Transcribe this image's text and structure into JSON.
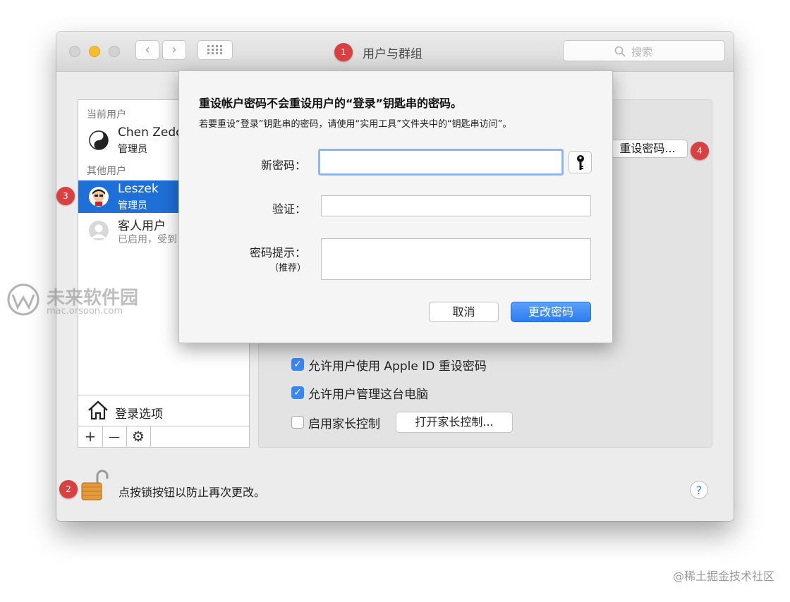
{
  "window": {
    "title": "用户与群组",
    "search_placeholder": "搜索",
    "nav_back": "‹",
    "nav_forward": "›",
    "grid_icon": "grid-icon"
  },
  "badges": [
    "1",
    "2",
    "3",
    "4"
  ],
  "sidebar": {
    "current_section": "当前用户",
    "current_user": {
      "name": "Chen Zedo",
      "role": "管理员",
      "icon": "yin-yang-icon"
    },
    "other_section": "其他用户",
    "users": [
      {
        "name": "Leszek",
        "role": "管理员",
        "selected": true,
        "icon": "avatar-icon"
      },
      {
        "name": "客人用户",
        "role": "已启用，受到",
        "selected": false,
        "icon": "guest-icon"
      }
    ],
    "login_options": "登录选项",
    "add": "+",
    "remove": "—"
  },
  "panel": {
    "reset_password_button": "重设密码...",
    "checkboxes": [
      {
        "label": "允许用户使用 Apple ID 重设密码",
        "checked": true
      },
      {
        "label": "允许用户管理这台电脑",
        "checked": true
      },
      {
        "label": "启用家长控制",
        "checked": false
      }
    ],
    "parental_button": "打开家长控制..."
  },
  "dialog": {
    "title": "重设帐户密码不会重设用户的“登录”钥匙串的密码。",
    "subtitle": "若要重设“登录”钥匙串的密码，请使用“实用工具”文件夹中的“钥匙串访问”。",
    "new_password_label": "新密码：",
    "verify_label": "验证：",
    "hint_label": "密码提示：",
    "hint_sub": "（推荐）",
    "cancel": "取消",
    "confirm": "更改密码"
  },
  "footer": {
    "lock_text": "点按锁按钮以防止再次更改。",
    "help": "?"
  },
  "watermark": {
    "line1": "未来软件园",
    "line2": "mac.orsoon.com"
  },
  "credit": "@稀土掘金技术社区",
  "colors": {
    "accent": "#3b86f5",
    "badge": "#d94040",
    "selection": "#1f6fd8"
  }
}
